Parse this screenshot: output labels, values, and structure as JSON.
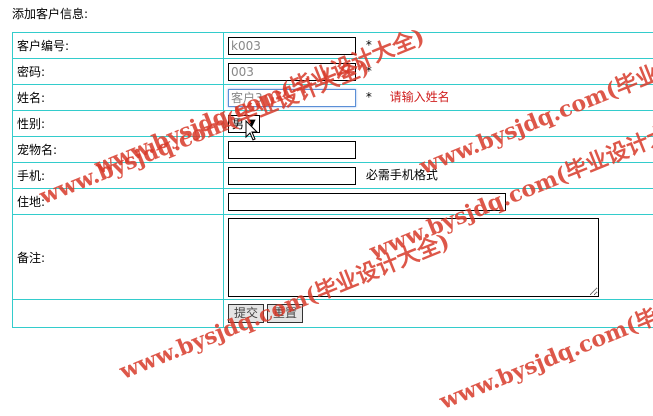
{
  "page": {
    "title": "添加客户信息:"
  },
  "form": {
    "customer_id": {
      "label": "客户编号:",
      "value": "k003",
      "required": "*"
    },
    "password": {
      "label": "密码:",
      "value": "003",
      "required": "*"
    },
    "name": {
      "label": "姓名:",
      "value": "客户3",
      "required": "*",
      "error": "请输入姓名"
    },
    "gender": {
      "label": "性别:",
      "selected": "男"
    },
    "pet_name": {
      "label": "宠物名:",
      "value": ""
    },
    "phone": {
      "label": "手机:",
      "value": "",
      "hint": "必需手机格式"
    },
    "address": {
      "label": "住地:",
      "value": ""
    },
    "notes": {
      "label": "备注:",
      "value": ""
    }
  },
  "actions": {
    "submit_label": "提交",
    "reset_label": "重置"
  },
  "watermark": {
    "text": "www.bysjdq.com(毕业设计大全)"
  },
  "colors": {
    "table_border": "#33cccc",
    "error_text": "#d02020",
    "watermark": "#d83a2a"
  }
}
